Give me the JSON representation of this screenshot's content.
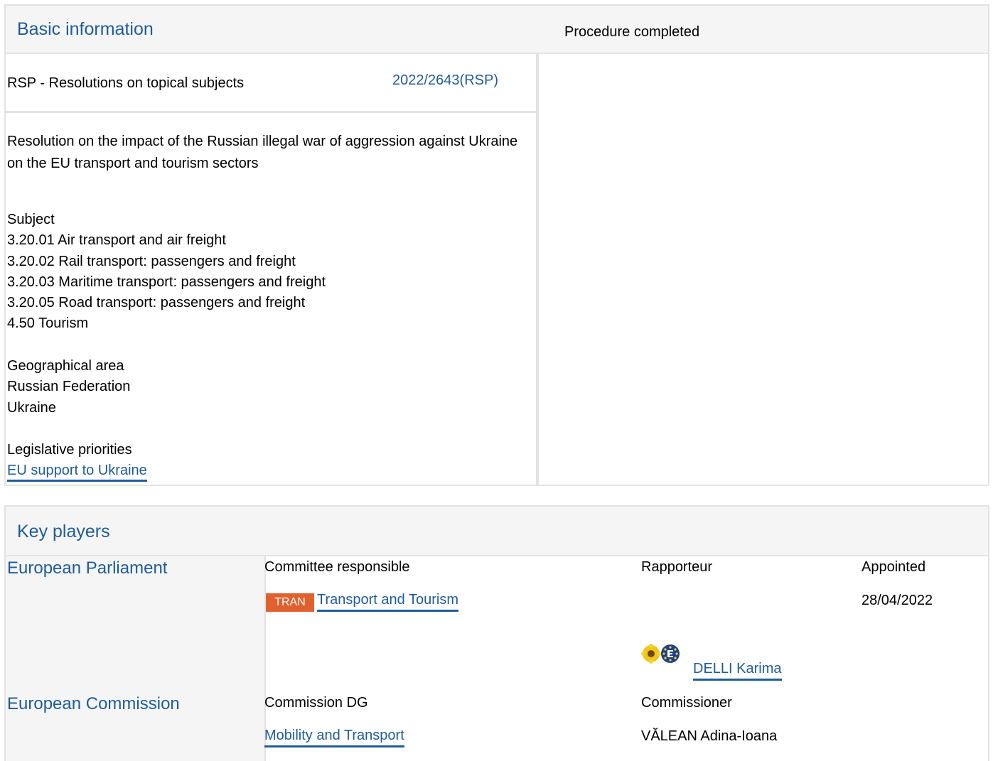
{
  "basic": {
    "title": "Basic information",
    "procedure_type": "RSP - Resolutions on topical subjects",
    "reference": "2022/2643(RSP)",
    "status": "Procedure completed",
    "description": "Resolution on the impact of the Russian illegal war of aggression against Ukraine on the EU transport and tourism sectors",
    "subject": {
      "label": "Subject",
      "items": [
        "3.20.01 Air transport and air freight",
        "3.20.02 Rail transport: passengers and freight",
        "3.20.03 Maritime transport: passengers and freight",
        "3.20.05 Road transport: passengers and freight",
        "4.50 Tourism"
      ]
    },
    "geo": {
      "label": "Geographical area",
      "items": [
        "Russian Federation",
        "Ukraine"
      ]
    },
    "priorities": {
      "label": "Legislative priorities",
      "link": "EU support to Ukraine"
    }
  },
  "players": {
    "title": "Key players",
    "ep": {
      "name": "European Parliament",
      "committee_label": "Committee responsible",
      "rapporteur_label": "Rapporteur",
      "appointed_label": "Appointed",
      "committee_code": "TRAN",
      "committee_name": "Transport and Tourism",
      "appointed_date": "28/04/2022",
      "rapporteur_name": "DELLI Karima"
    },
    "ec": {
      "name": "European Commission",
      "dg_label": "Commission DG",
      "commissioner_label": "Commissioner",
      "dg_name": "Mobility and Transport",
      "commissioner_name": "VĂLEAN Adina-Ioana"
    }
  },
  "colors": {
    "link": "#1f5c99",
    "header_bg": "#f5f5f5",
    "border": "#e3e3e3",
    "tag_bg": "#e0612e"
  },
  "icons": {
    "group_logo": "greens-efa-logo"
  }
}
